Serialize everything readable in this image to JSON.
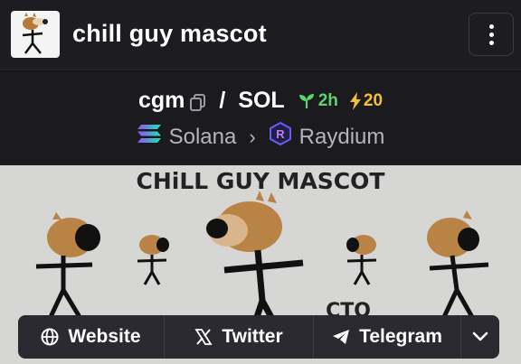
{
  "header": {
    "title": "chill guy mascot",
    "menu_icon": "more-vertical-icon"
  },
  "pair": {
    "base": "cgm",
    "separator": "/",
    "quote": "SOL",
    "age": "2h",
    "boosts": "20",
    "colors": {
      "age": "#5bd46e",
      "boost": "#f2c230"
    }
  },
  "chain": {
    "network": "Solana",
    "dex": "Raydium"
  },
  "banner": {
    "heading": "CHiLL GUY MASCOT",
    "subtext": "CTO"
  },
  "socials": [
    {
      "label": "Website",
      "icon": "globe-icon"
    },
    {
      "label": "Twitter",
      "icon": "x-icon"
    },
    {
      "label": "Telegram",
      "icon": "telegram-icon"
    }
  ]
}
